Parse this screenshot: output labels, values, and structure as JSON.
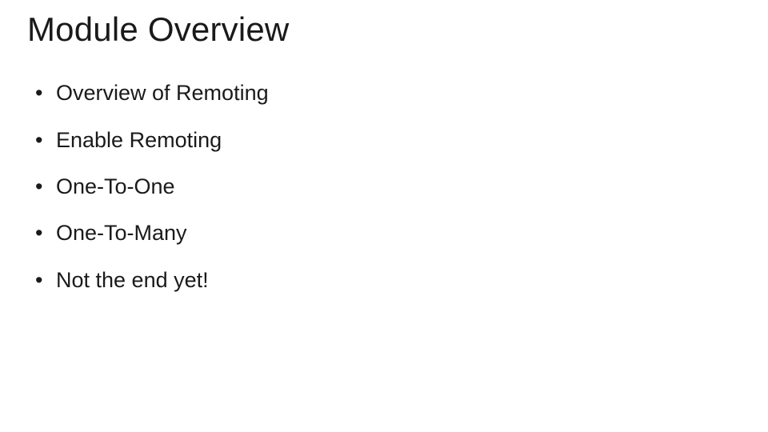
{
  "slide": {
    "title": "Module Overview",
    "bullets": [
      "Overview of Remoting",
      "Enable Remoting",
      "One-To-One",
      "One-To-Many",
      "Not the end yet!"
    ]
  }
}
